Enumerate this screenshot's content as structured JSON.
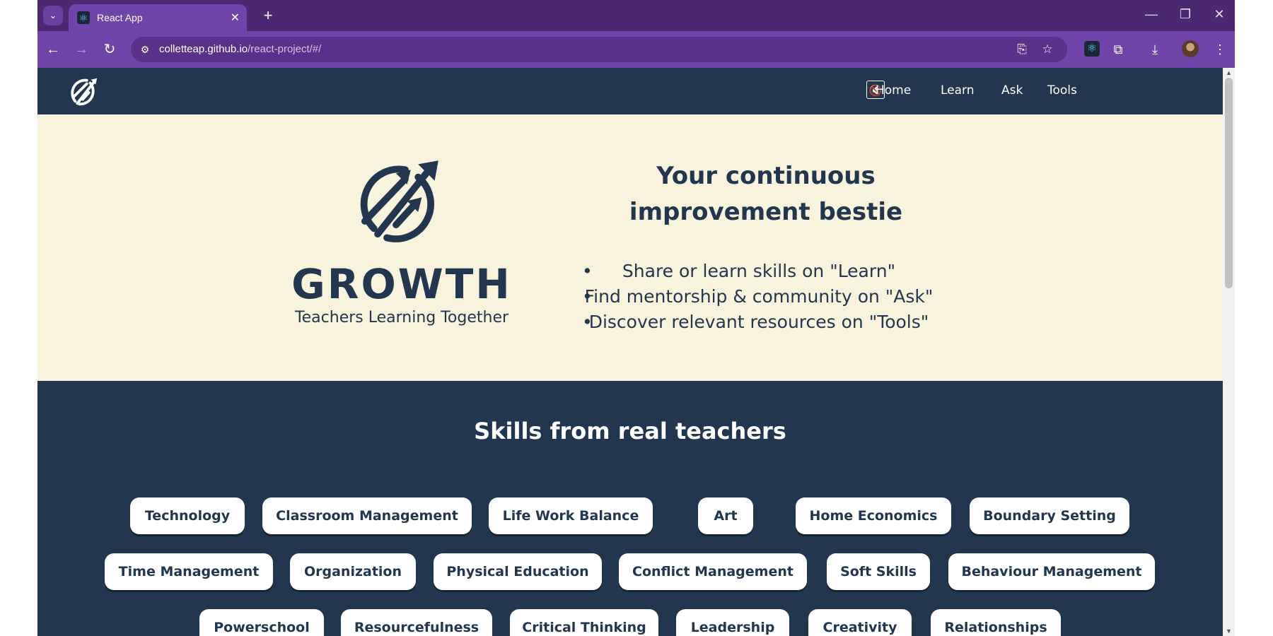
{
  "browser": {
    "tab_title": "React App",
    "url_host": "colletteap.github.io",
    "url_path": "/react-project/#/",
    "icons": {
      "tab_menu": "chevron-down-icon",
      "new_tab": "plus-icon",
      "back": "arrow-left-icon",
      "forward": "arrow-right-icon",
      "reload": "reload-icon",
      "install": "install-app-icon",
      "bookmark": "star-icon",
      "extension": "react-devtools-icon",
      "extensions": "puzzle-icon",
      "downloads": "download-icon",
      "menu": "kebab-menu-icon"
    }
  },
  "site": {
    "nav": {
      "links": [
        "Home",
        "Learn",
        "Ask",
        "Tools"
      ],
      "mute_icon": "speaker-muted-icon"
    },
    "hero": {
      "brand": "GROWTH",
      "tagline": "Teachers Learning Together",
      "headline_line1": "Your continuous",
      "headline_line2": "improvement bestie",
      "bullets": [
        "Share or learn skills on \"Learn\"",
        "Find mentorship & community on \"Ask\"",
        "Discover relevant resources on \"Tools\""
      ]
    },
    "skills": {
      "title": "Skills from real teachers",
      "rows": [
        [
          "Technology",
          "Classroom Management",
          "Life Work Balance",
          "Art",
          "Home Economics",
          "Boundary Setting"
        ],
        [
          "Time Management",
          "Organization",
          "Physical Education",
          "Conflict Management",
          "Soft Skills",
          "Behaviour Management"
        ],
        [
          "Powerschool",
          "Resourcefulness",
          "Critical Thinking",
          "Leadership",
          "Creativity",
          "Relationships"
        ]
      ]
    }
  },
  "colors": {
    "navy": "#23364f",
    "cream": "#f8f3dc",
    "browser_purple": "#7044a8",
    "browser_purple_dark": "#4b2870"
  }
}
